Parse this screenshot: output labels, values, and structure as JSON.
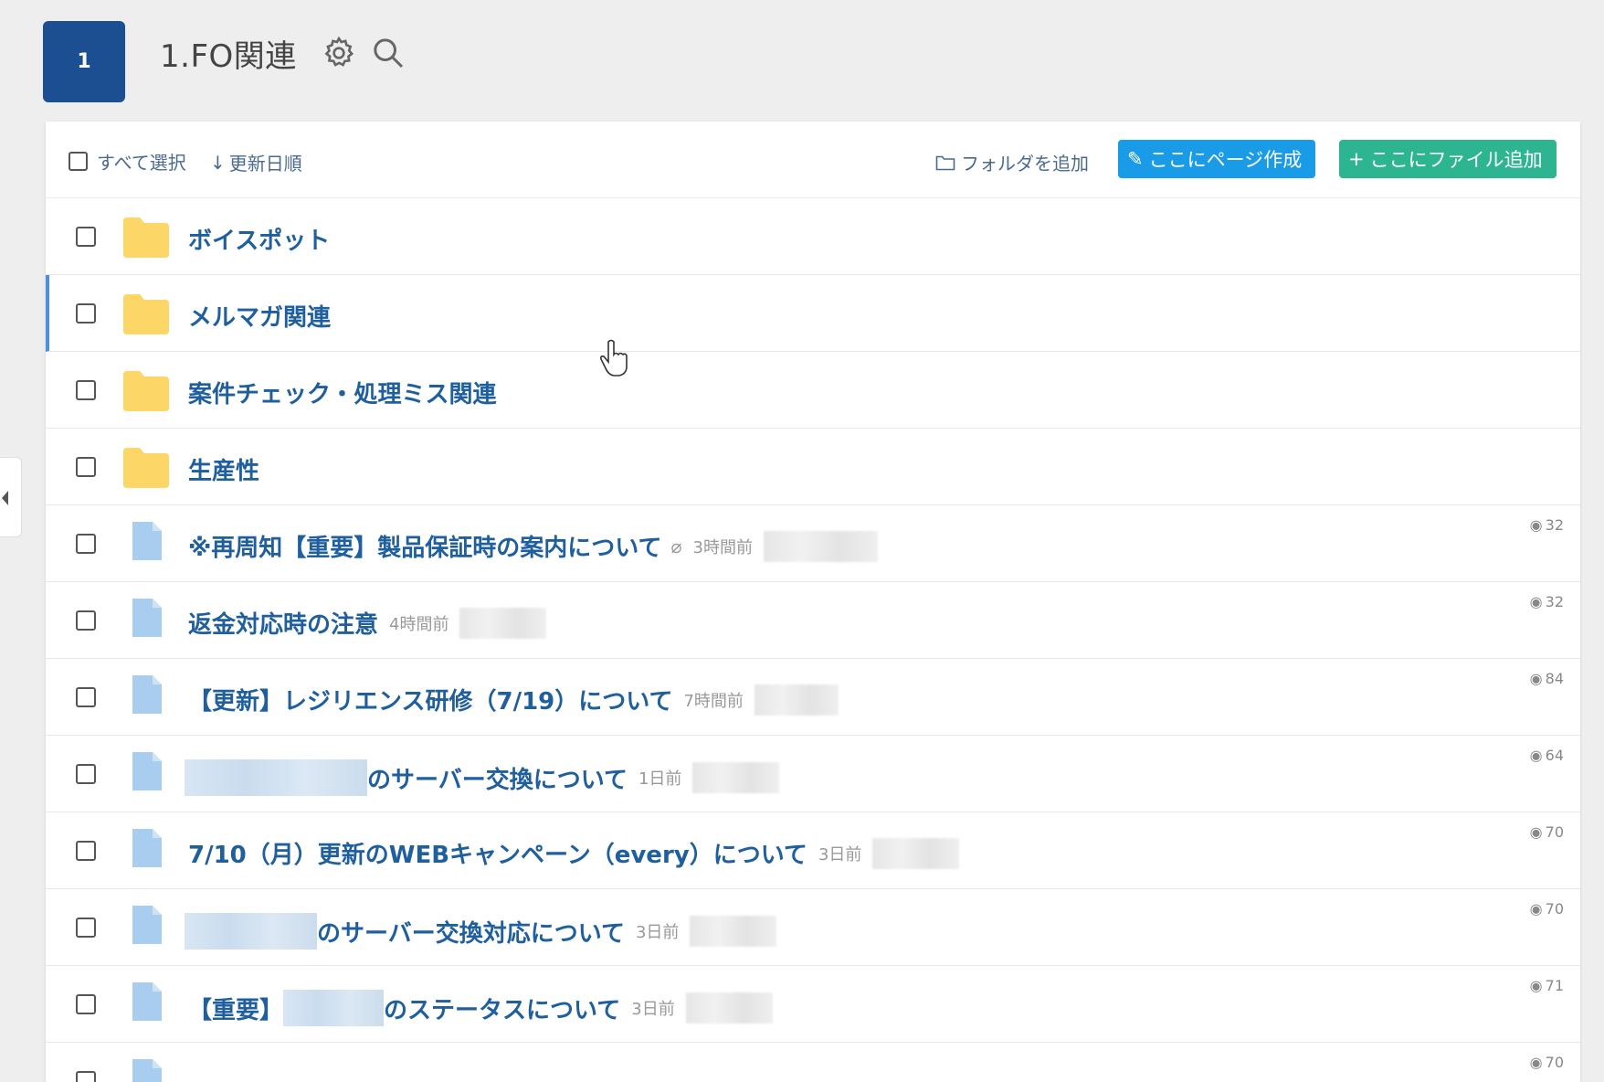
{
  "header": {
    "badge": "1",
    "title": "1.FO関連",
    "icons": [
      "gear-icon",
      "search-icon"
    ]
  },
  "toolbar": {
    "select_all": "すべて選択",
    "sort": "更新日順",
    "add_folder": "フォルダを追加",
    "create_page": "ここにページ作成",
    "add_file": "ここにファイル追加"
  },
  "folders": [
    {
      "name": "ボイスポット"
    },
    {
      "name": "メルマガ関連"
    },
    {
      "name": "案件チェック・処理ミス関連"
    },
    {
      "name": "生産性"
    }
  ],
  "pages": [
    {
      "prefix": "",
      "name": "※再周知【重要】製品保証時の案内について",
      "attachment": true,
      "time": "3時間前",
      "views": "32"
    },
    {
      "prefix": "",
      "name": "返金対応時の注意",
      "attachment": false,
      "time": "4時間前",
      "views": "32"
    },
    {
      "prefix": "",
      "name": "【更新】レジリエンス研修（7/19）について",
      "attachment": false,
      "time": "7時間前",
      "views": "84"
    },
    {
      "prefix": "",
      "name": "のサーバー交換について",
      "attachment": false,
      "time": "1日前",
      "views": "64"
    },
    {
      "prefix": "",
      "name": "7/10（月）更新のWEBキャンペーン（every）について",
      "attachment": false,
      "time": "3日前",
      "views": "70"
    },
    {
      "prefix": "",
      "name": "のサーバー交換対応について",
      "attachment": false,
      "time": "3日前",
      "views": "70"
    },
    {
      "prefix": "【重要】",
      "name": "のステータスについて",
      "attachment": false,
      "time": "3日前",
      "views": "71"
    },
    {
      "prefix": "",
      "name": "",
      "attachment": false,
      "time": "",
      "views": "70"
    }
  ],
  "colors": {
    "badge": "#1c4f91",
    "link": "#1f5f9e",
    "create_page_button": "#1a9be8",
    "add_file_button": "#2db592",
    "folder": "#fcd667",
    "file": "#a8cdee"
  }
}
